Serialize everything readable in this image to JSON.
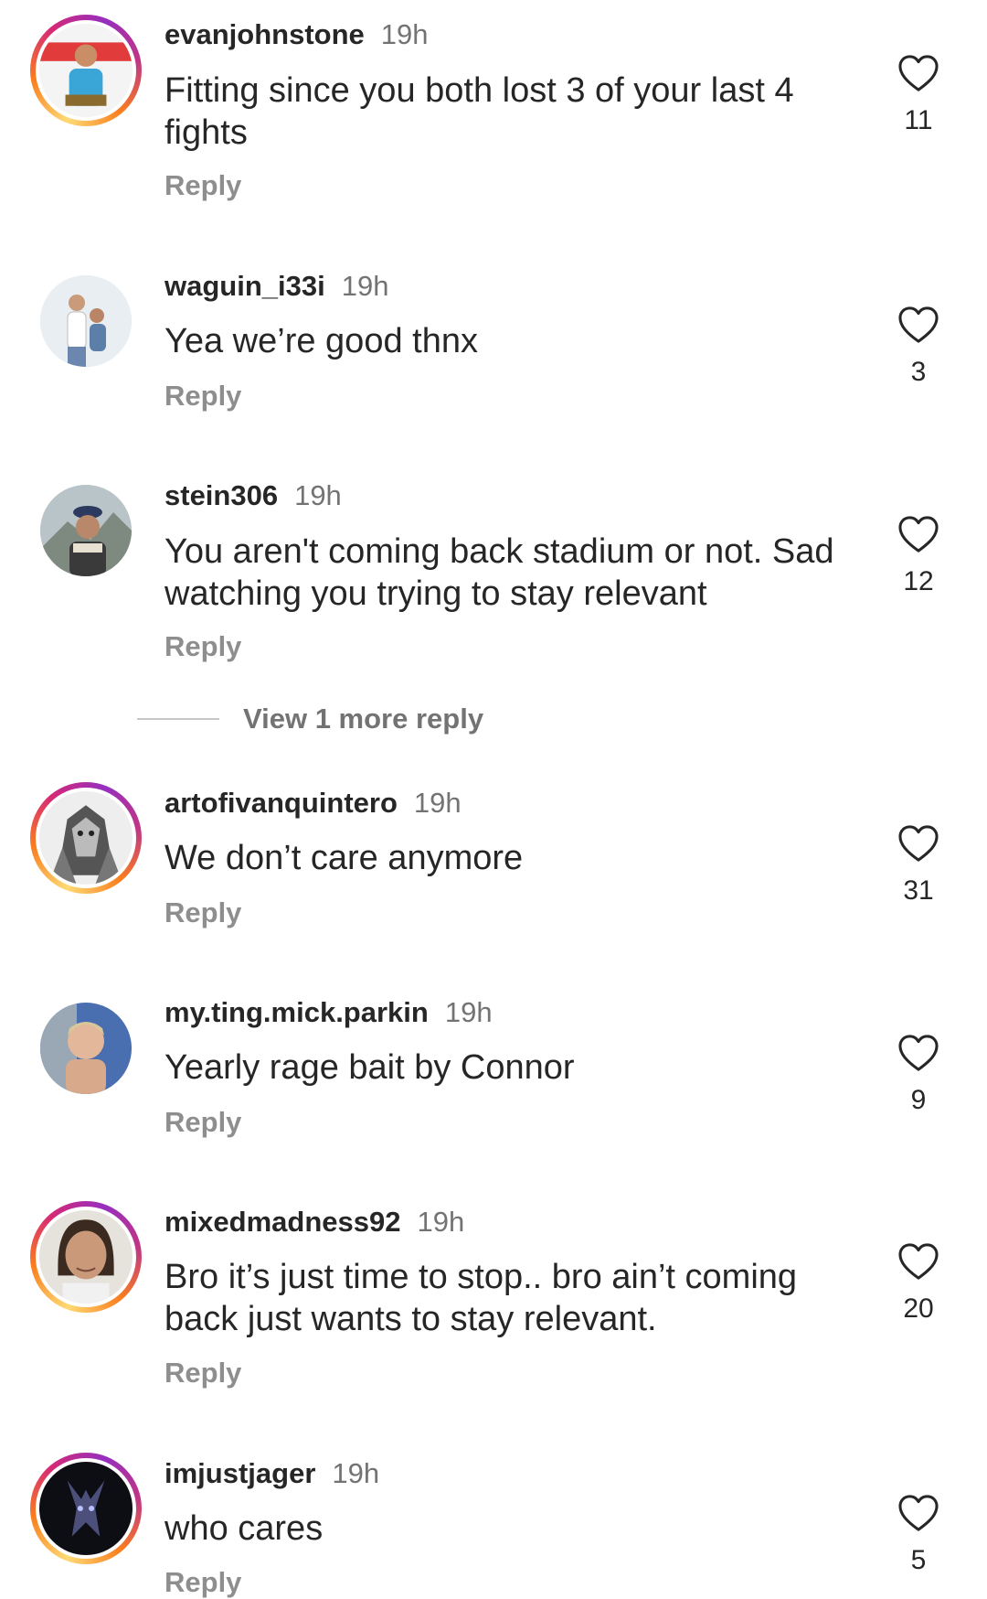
{
  "comments": [
    {
      "username": "evanjohnstone",
      "time": "19h",
      "text": "Fitting since you both lost 3 of your last 4 fights",
      "reply_label": "Reply",
      "likes": "11",
      "avatar_ring": true
    },
    {
      "username": "waguin_i33i",
      "time": "19h",
      "text": "Yea we’re good thnx",
      "reply_label": "Reply",
      "likes": "3",
      "avatar_ring": false
    },
    {
      "username": "stein306",
      "time": "19h",
      "text": "You aren't coming back stadium or not. Sad watching you trying to stay relevant",
      "reply_label": "Reply",
      "likes": "12",
      "avatar_ring": false
    },
    {
      "username": "artofivanquintero",
      "time": "19h",
      "text": "We don’t care anymore",
      "reply_label": "Reply",
      "likes": "31",
      "avatar_ring": true
    },
    {
      "username": "my.ting.mick.parkin",
      "time": "19h",
      "text": "Yearly rage bait by Connor",
      "reply_label": "Reply",
      "likes": "9",
      "avatar_ring": false
    },
    {
      "username": "mixedmadness92",
      "time": "19h",
      "text": "Bro it’s just time to stop.. bro ain’t coming back just wants to stay relevant.",
      "reply_label": "Reply",
      "likes": "20",
      "avatar_ring": true
    },
    {
      "username": "imjustjager",
      "time": "19h",
      "text": "who cares",
      "reply_label": "Reply",
      "likes": "5",
      "avatar_ring": true
    }
  ],
  "view_more_replies": "View 1 more reply",
  "icons": {
    "like": "heart-outline-icon"
  },
  "colors": {
    "text": "#262626",
    "secondary": "#737373",
    "reply": "#8e8e8e"
  }
}
